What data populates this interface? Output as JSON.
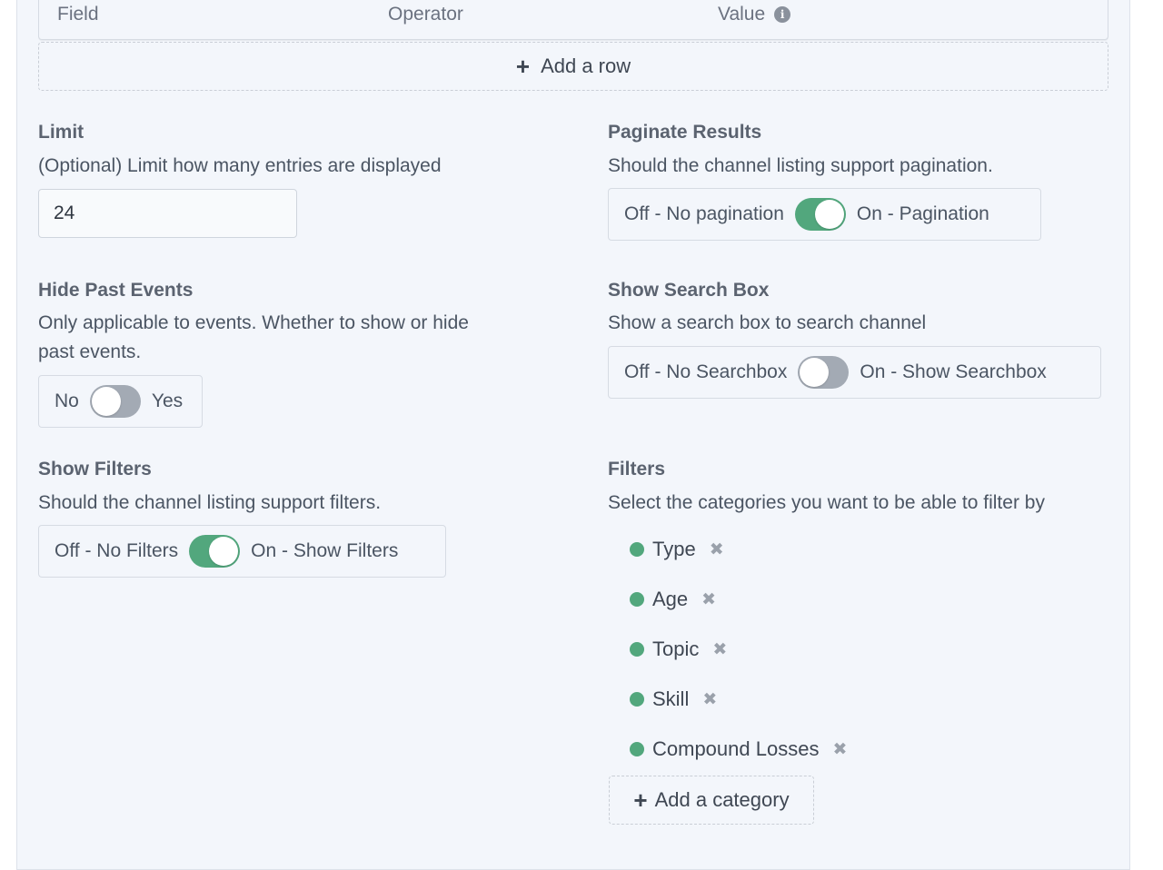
{
  "table": {
    "columns": [
      "Field",
      "Operator",
      "Value"
    ],
    "value_info_icon": "info-icon",
    "add_row_label": "Add a row"
  },
  "limit": {
    "title": "Limit",
    "description": "(Optional) Limit how many entries are displayed",
    "value": "24"
  },
  "paginate": {
    "title": "Paginate Results",
    "description": "Should the channel listing support pagination.",
    "off_label": "Off - No pagination",
    "on_label": "On - Pagination",
    "state": "on"
  },
  "hide_past": {
    "title": "Hide Past Events",
    "description_line1": "Only applicable to events. Whether to show or hide",
    "description_line2": "past events.",
    "off_label": "No",
    "on_label": "Yes",
    "state": "off"
  },
  "search_box": {
    "title": "Show Search Box",
    "description": "Show a search box to search channel",
    "off_label": "Off - No Searchbox",
    "on_label": "On - Show Searchbox",
    "state": "off"
  },
  "show_filters": {
    "title": "Show Filters",
    "description": "Should the channel listing support filters.",
    "off_label": "Off - No Filters",
    "on_label": "On - Show Filters",
    "state": "on"
  },
  "filters": {
    "title": "Filters",
    "description": "Select the categories you want to be able to filter by",
    "categories": [
      "Type",
      "Age",
      "Topic",
      "Skill",
      "Compound Losses"
    ],
    "add_label": "Add a category"
  },
  "colors": {
    "toggle_on": "#52a77d",
    "toggle_off": "#a3aab4",
    "panel_bg": "#f3f6fb"
  }
}
